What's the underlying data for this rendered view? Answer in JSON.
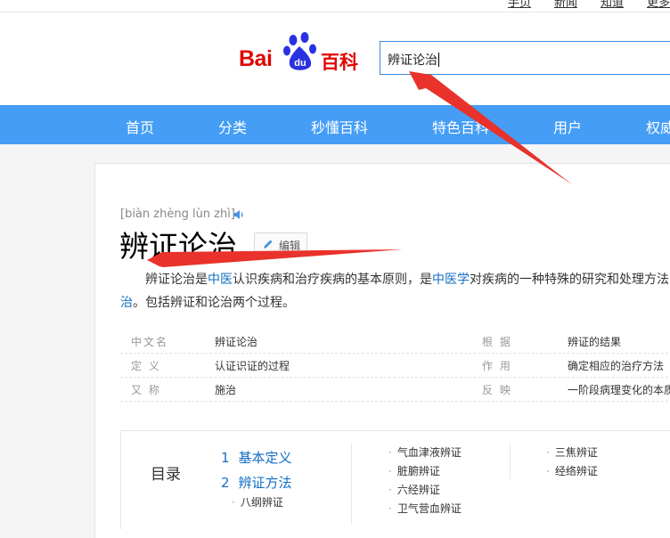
{
  "topnav": {
    "items": [
      "手页",
      "新闻",
      "知道",
      "更多"
    ]
  },
  "logo": {
    "bai": "Bai",
    "du": "du",
    "baike": "百科"
  },
  "search": {
    "value": "辨证论治"
  },
  "nav": {
    "items": [
      "首页",
      "分类",
      "秒懂百科",
      "特色百科",
      "用户",
      "权威"
    ]
  },
  "entry": {
    "pinyin": "[biàn zhèng lùn zhì]",
    "title": "辨证论治",
    "edit_label": "编辑",
    "summary": {
      "p1": "辨证论治是",
      "link1": "中医",
      "p2": "认识疾病和治疗疾病的基本原则，是",
      "link2": "中医学",
      "p3": "对疾病的一种特殊的研究和处理方法",
      "link3": "治",
      "p4": "。包括辨证和论治两个过程。"
    }
  },
  "infobox": {
    "rows": [
      {
        "k1": "中文名",
        "v1": "辨证论治",
        "k2": "根  据",
        "v2": "辨证的结果"
      },
      {
        "k1": "定  义",
        "v1": "认证识证的过程",
        "k2": "作  用",
        "v2": "确定相应的治疗方法"
      },
      {
        "k1": "又  称",
        "v1": "施治",
        "k2": "反  映",
        "v2": "一阶段病理变化的本质"
      }
    ]
  },
  "toc": {
    "head": "目录",
    "main": [
      {
        "num": "1",
        "label": "基本定义"
      },
      {
        "num": "2",
        "label": "辨证方法"
      }
    ],
    "sub_main": [
      "八纲辨证"
    ],
    "col2": [
      "气血津液辨证",
      "脏腑辨证",
      "六经辨证",
      "卫气营血辨证"
    ],
    "col3": [
      "三焦辨证",
      "经络辨证"
    ]
  },
  "colors": {
    "nav_bg": "#459df5",
    "link": "#136ec2",
    "arrow": "#e8322b",
    "logo_red": "#e10601",
    "logo_blue": "#2932e1"
  }
}
